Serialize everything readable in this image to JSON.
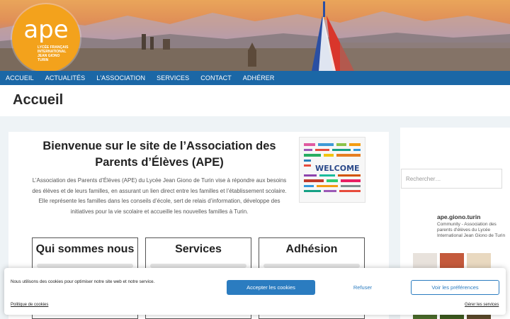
{
  "logo": {
    "main": "ape",
    "sub": [
      "LYCÉE FRANÇAIS",
      "INTERNATIONAL",
      "JEAN GIONO",
      "TURIN"
    ]
  },
  "nav": [
    "ACCUEIL",
    "ACTUALITÉS",
    "L'ASSOCIATION",
    "SERVICES",
    "CONTACT",
    "ADHÉRER"
  ],
  "page_title": "Accueil",
  "main": {
    "welcome_title": "Bienvenue sur le site de l’Association des Parents d’Élèves (APE)",
    "intro": "L’Association des Parents d’Élèves (APE) du Lycée Jean Giono de Turin vise à répondre aux besoins des élèves et de leurs familles, en assurant un lien direct entre les familles et l’établissement scolaire. Elle représente les familles dans les conseils d’école, sert de relais d’information, développe des initiatives pour la vie scolaire et accueille les nouvelles familles à Turin.",
    "welcome_word": "WELCOME",
    "boxes": [
      "Qui sommes nous",
      "Services",
      "Adhésion"
    ]
  },
  "sidebar": {
    "search_placeholder": "Rechercher…",
    "insta_name": "ape.giono.turin",
    "insta_desc": "Community - Association des parents d'élèves du Lycée International Jean Giono de Turin"
  },
  "cookie": {
    "text": "Nous utilisons des cookies pour optimiser notre site web et notre service.",
    "accept": "Accepter les cookies",
    "refuse": "Refuser",
    "prefs": "Voir les préférences",
    "policy": "Politique de cookies",
    "manage": "Gérer les services"
  },
  "colors": {
    "nav": "#1b67a6",
    "logo": "#f3a21c",
    "button": "#2b7cc0"
  }
}
